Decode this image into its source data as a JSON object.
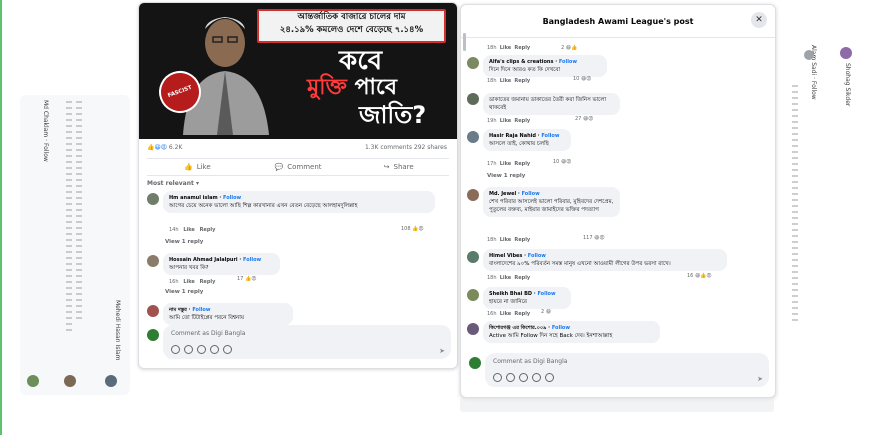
{
  "left_post": {
    "hero": {
      "banner_line1": "আন্তর্জাতিক বাজারে চালের দাম",
      "banner_line2": "২৪.১৯% কমলেও দেশে বেড়েছে ৭.১৪%",
      "badge": "FASCIST",
      "slogan_1": "কবে",
      "slogan_2a": "মুক্তি",
      "slogan_2b": "পাবে",
      "slogan_3": "জাতি?"
    },
    "reactions_count": "6.2K",
    "comments_shares": "1.3K comments  292 shares",
    "like_label": "Like",
    "comment_label": "Comment",
    "share_label": "Share",
    "most_relevant": "Most relevant",
    "comments": [
      {
        "name": "Hm anamul islam",
        "follow": "Follow",
        "text": "আগের চেয়ে অনেক ভালো আছি শিল্প কারখানার এখন বেতন বেড়েছে আলহামদুলিল্লাহ",
        "time": "14h",
        "like": "Like",
        "reply": "Reply",
        "reacts": "108",
        "view": "View 1 reply"
      },
      {
        "name": "Hossain Ahmad Jalalpuri",
        "follow": "Follow",
        "text": "আপনার খবর কি?",
        "time": "16h",
        "like": "Like",
        "reply": "Reply",
        "reacts": "17",
        "view": "View 1 reply"
      },
      {
        "name": "নাম দস্তুর",
        "follow": "Follow",
        "text": "আমি তো টিটাইপ্লের পরনে বিশ্বনায়",
        "time": "",
        "like": "",
        "reply": "",
        "reacts": "",
        "view": ""
      }
    ],
    "composer_placeholder": "Comment as Digi Bangla"
  },
  "dialog": {
    "title": "Bangladesh Awami League's post",
    "close": "✕",
    "comments": [
      {
        "name": "",
        "follow": "",
        "text": "",
        "time": "18h",
        "like": "Like",
        "reply": "Reply",
        "reacts": "2"
      },
      {
        "name": "Alfa's clips & creations",
        "follow": "Follow",
        "text": "দিনে দিনে আরও কত কি দেখবো",
        "time": "18h",
        "like": "Like",
        "reply": "Reply",
        "reacts": "10"
      },
      {
        "name": "",
        "follow": "",
        "text": "ডাকাতের জমানায় ডাকাতের তৈরী করা জিনিস ভালো থাকবেই",
        "time": "19h",
        "like": "Like",
        "reply": "Reply",
        "reacts": "27"
      },
      {
        "name": "Hasir Raja Nahid",
        "follow": "Follow",
        "text": "আসলে তাই, কোথায় চলছি",
        "time": "17h",
        "like": "Like",
        "reply": "Reply",
        "reacts": "10",
        "view": "View 1 reply"
      },
      {
        "name": "Md. Jewel",
        "follow": "Follow",
        "text": "শেখ পরিবার আসলেই ভালো পরিবার, মুহিবদের দেশপ্রেম, পুতুলের বক্তব্য, মাইয়ার জামাইদের ভক্তির পদত্যাগ",
        "time": "18h",
        "like": "Like",
        "reply": "Reply",
        "reacts": "117"
      },
      {
        "name": "Himel Vibes",
        "follow": "Follow",
        "text": "বাংলাদেশের ৯০% পরিবর্তন সমস্ত মানুষ এখনো আওয়ামী লীগের উপর ভরসা রাখে।",
        "time": "18h",
        "like": "Like",
        "reply": "Reply",
        "reacts": "16"
      },
      {
        "name": "Sheikh Bhai BD",
        "follow": "Follow",
        "text": "হায়রে না জানিরে",
        "time": "16h",
        "like": "Like",
        "reply": "Reply",
        "reacts": "2"
      },
      {
        "name": "কিশোরগঞ্জ এর কিশোর.০০৯",
        "follow": "Follow",
        "text": "Active আমি Follow দিন সহে Back দেব। ইনশাআল্লাহ",
        "time": "",
        "like": "",
        "reply": "",
        "reacts": ""
      }
    ],
    "composer_placeholder": "Comment as Digi Bangla"
  },
  "side_text": {
    "left_a": "Md Chaklam · Follow",
    "left_b": "Mehedi Hasan Islam",
    "right_a": "Alam Sadi · Follow",
    "right_b": "Shohag Sikder"
  },
  "colors": {
    "accent": "#1877f2",
    "frame": "#5cc36b",
    "banner_border": "#d32f2f"
  }
}
